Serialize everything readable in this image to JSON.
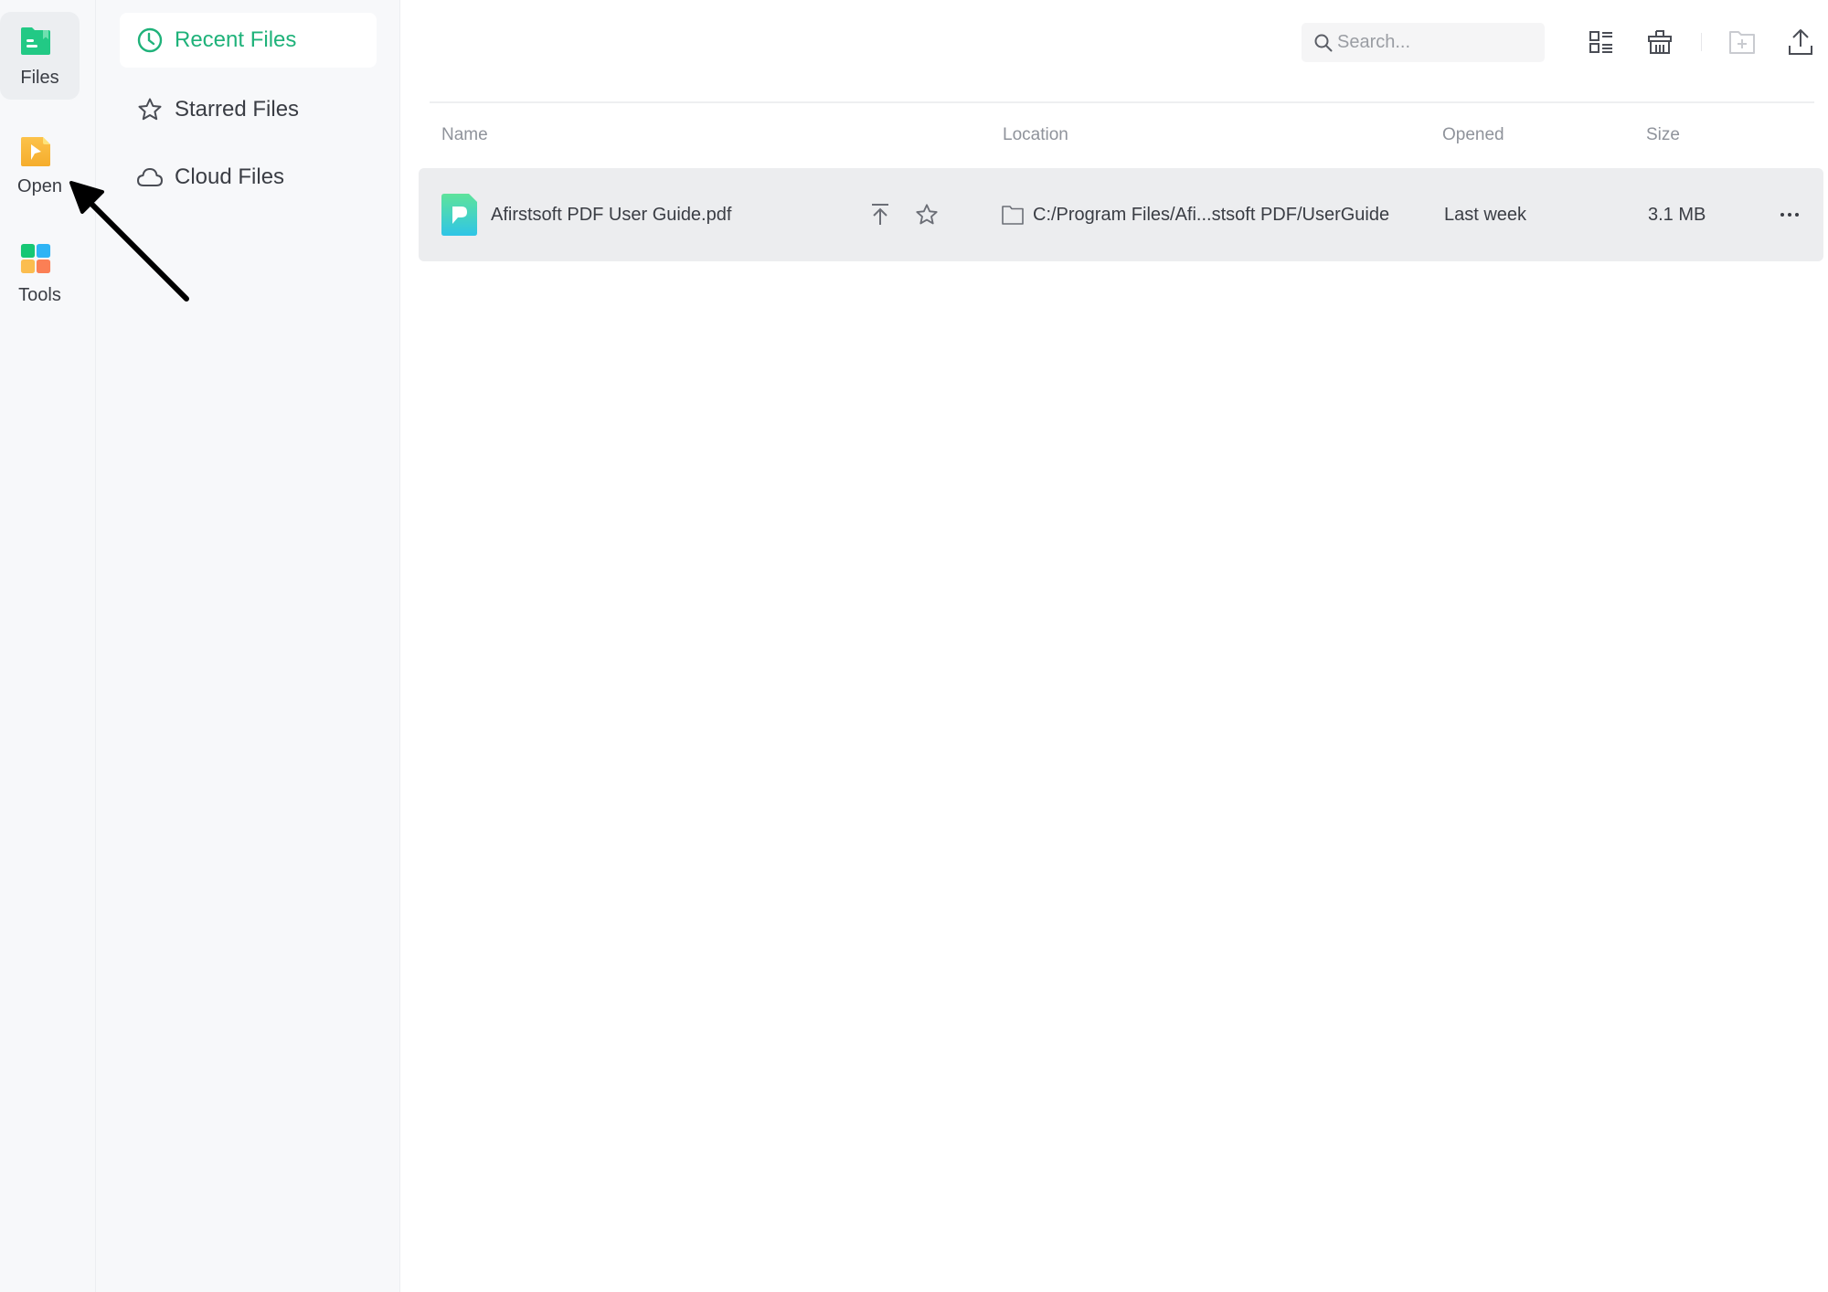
{
  "rail": {
    "items": [
      {
        "label": "Files",
        "icon": "files-folder-icon",
        "active": true
      },
      {
        "label": "Open",
        "icon": "open-file-icon",
        "active": false
      },
      {
        "label": "Tools",
        "icon": "tools-grid-icon",
        "active": false
      }
    ]
  },
  "sidebar": {
    "items": [
      {
        "label": "Recent Files",
        "icon": "clock-icon",
        "active": true
      },
      {
        "label": "Starred Files",
        "icon": "star-icon",
        "active": false
      },
      {
        "label": "Cloud Files",
        "icon": "cloud-icon",
        "active": false
      }
    ]
  },
  "toolbar": {
    "search_placeholder": "Search...",
    "search_value": "",
    "buttons": [
      "list-view-icon",
      "trash-icon",
      "new-folder-icon",
      "upload-icon"
    ]
  },
  "table": {
    "columns": [
      "Name",
      "Location",
      "Opened",
      "Size"
    ],
    "rows": [
      {
        "name": "Afirstsoft PDF User Guide.pdf",
        "location": "C:/Program Files/Afi...stsoft PDF/UserGuide",
        "opened": "Last week",
        "size": "3.1 MB"
      }
    ]
  },
  "colors": {
    "accent": "#1fb27a",
    "rail_bg": "#f7f8fa",
    "row_bg": "#ecedef"
  }
}
